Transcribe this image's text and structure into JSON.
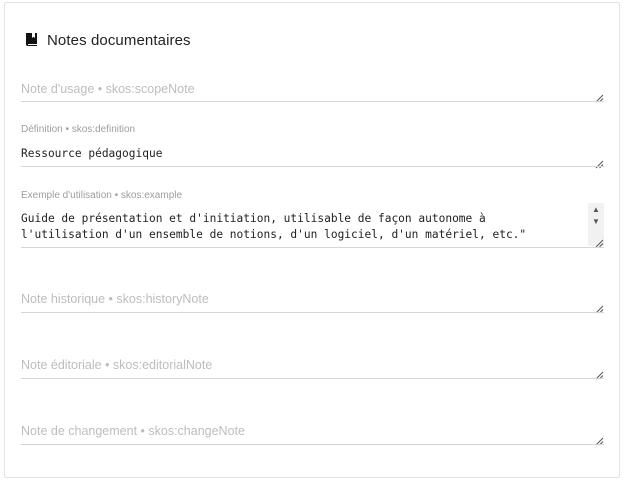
{
  "section": {
    "title": "Notes documentaires"
  },
  "fields": {
    "scope_note": {
      "placeholder": "Note d'usage • skos:scopeNote"
    },
    "definition": {
      "label": "Définition • skos:definition",
      "value": "Ressource pédagogique"
    },
    "example": {
      "label": "Exemple d'utilisation • skos:example",
      "value_line1": "Guide de présentation et d'initiation, utilisable de façon autonome à",
      "value_line2": "l'utilisation d'un ensemble de notions, d'un logiciel, d'un matériel, etc.\""
    },
    "history_note": {
      "placeholder": "Note historique • skos:historyNote"
    },
    "editorial_note": {
      "placeholder": "Note éditoriale • skos:editorialNote"
    },
    "change_note": {
      "placeholder": "Note de changement • skos:changeNote"
    }
  },
  "icons": {
    "section_icon": "book-icon",
    "scroll_up": "triangle-up-icon",
    "scroll_down": "triangle-down-icon",
    "resize": "resize-grip-icon"
  },
  "colors": {
    "text": "#222222",
    "label": "#9e9e9e",
    "placeholder": "#bdbdbd",
    "underline": "#d6d6d6",
    "border": "#e3e3e3"
  }
}
